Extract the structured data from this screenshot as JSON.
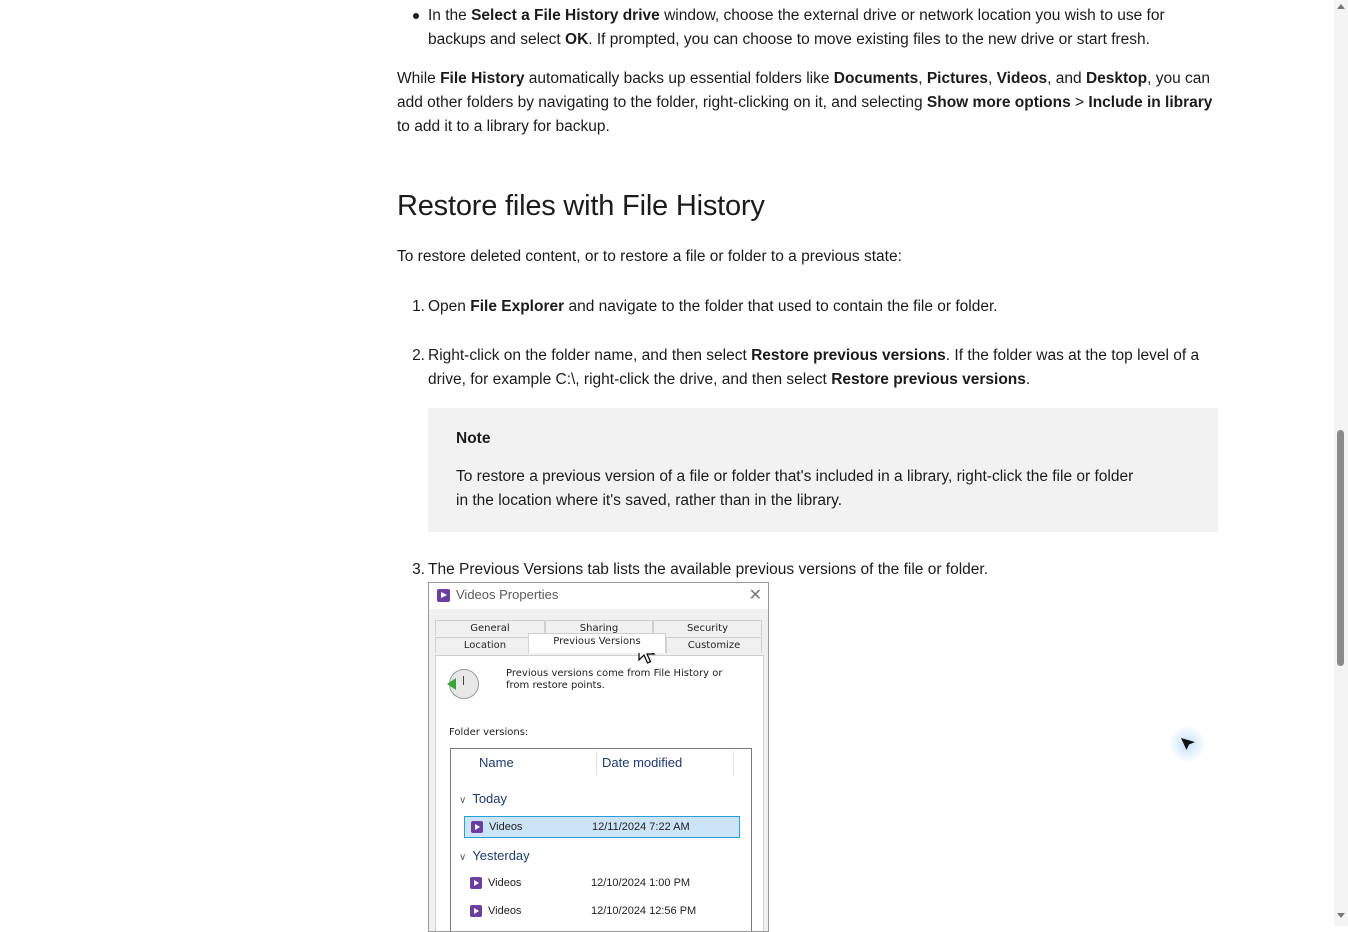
{
  "bullet_item": {
    "t1": "In the ",
    "b1": "Select a File History drive",
    "t2": " window, choose the external drive or network location you wish to use for backups and select ",
    "b2": "OK",
    "t3": ". If prompted, you can choose to move existing files to the new drive or start fresh."
  },
  "paragraph_backup": {
    "t1": "While ",
    "b1": "File History",
    "t2": " automatically backs up essential folders like ",
    "b2": "Documents",
    "t3": ", ",
    "b3": "Pictures",
    "t4": ", ",
    "b4": "Videos",
    "t5": ", and ",
    "b5": "Desktop",
    "t6": ", you can add other folders by navigating to the folder, right-clicking on it, and selecting ",
    "b6": "Show more options",
    "t7": " > ",
    "b7": "Include in library",
    "t8": " to add it to a library for backup."
  },
  "heading": "Restore files with File History",
  "intro": "To restore deleted content, or to restore a file or folder to a previous state:",
  "steps": [
    {
      "num": "1.",
      "t1": "Open ",
      "b1": "File Explorer",
      "t2": " and navigate to the folder that used to contain the file or folder."
    },
    {
      "num": "2.",
      "t1": "Right-click on the folder name, and then select ",
      "b1": "Restore previous versions",
      "t2": ". If the folder was at the top level of a drive, for example C:\\, right-click the drive, and then select ",
      "b2": "Restore previous versions",
      "t3": "."
    },
    {
      "num": "3.",
      "text": "The Previous Versions tab lists the available previous versions of the file or folder."
    }
  ],
  "note": {
    "title": "Note",
    "text": "To restore a previous version of a file or folder that's included in a library, right-click the file or folder in the location where it's saved, rather than in the library."
  },
  "dialog": {
    "title": "Videos Properties",
    "close": "✕",
    "tabs_row1": [
      "General",
      "Sharing",
      "Security"
    ],
    "tabs_row2": [
      "Location",
      "Previous Versions",
      "Customize"
    ],
    "info": "Previous versions come from File History or from restore points.",
    "folder_versions_label": "Folder versions:",
    "columns": [
      "Name",
      "Date modified"
    ],
    "groups": [
      {
        "label": "Today",
        "rows": [
          {
            "name": "Videos",
            "date": "12/11/2024 7:22 AM",
            "selected": true
          }
        ]
      },
      {
        "label": "Yesterday",
        "rows": [
          {
            "name": "Videos",
            "date": "12/10/2024 1:00 PM"
          },
          {
            "name": "Videos",
            "date": "12/10/2024 12:56 PM"
          }
        ]
      }
    ]
  },
  "icons": [
    "bullet-icon",
    "videos-folder-icon",
    "close-icon",
    "previous-versions-clock-icon",
    "chevron-down-icon",
    "mouse-pointer-icon",
    "cursor-highlight-icon"
  ],
  "colors": {
    "note_bg": "#f2f2f2",
    "selection": "#cce4f7",
    "accent_purple": "#6b3fa0",
    "group_blue": "#1e3a6e"
  }
}
